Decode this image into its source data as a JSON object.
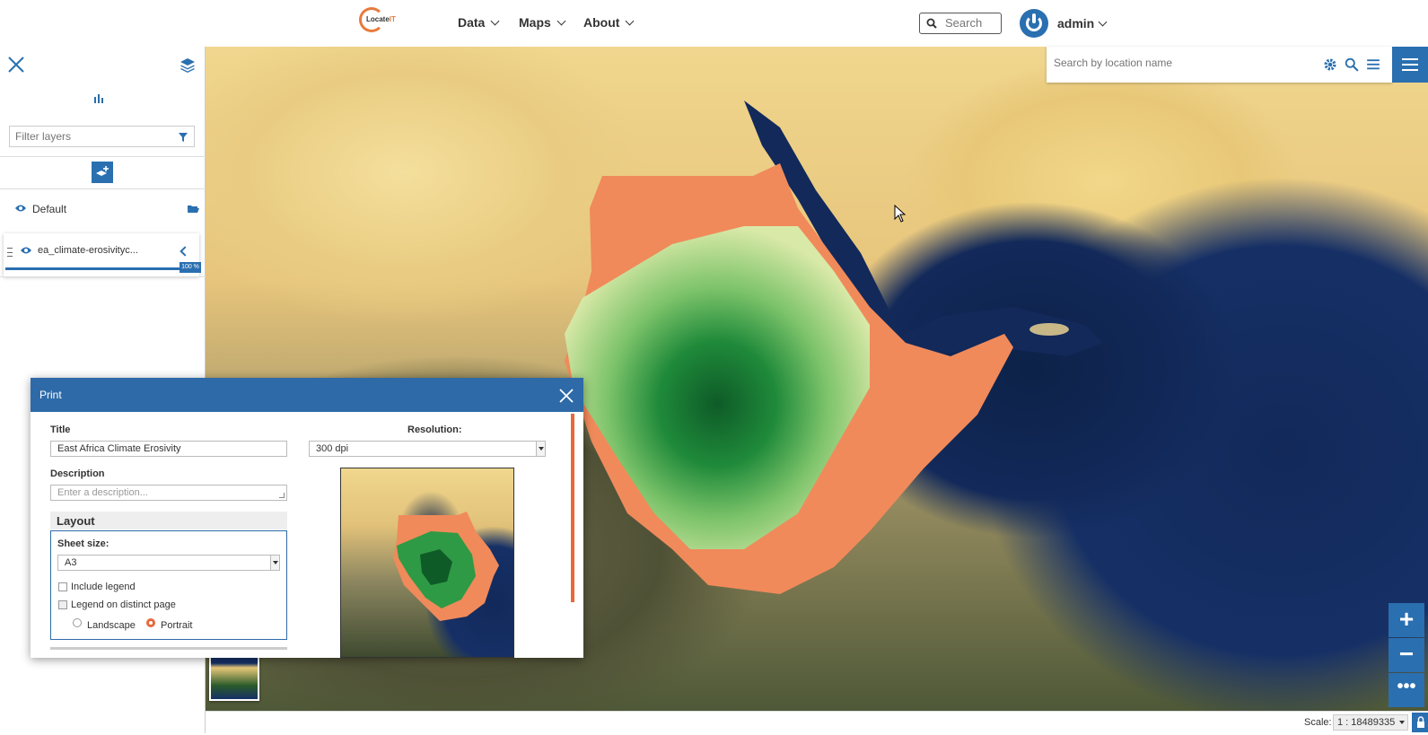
{
  "brand": {
    "logo_text": "Locate",
    "logo_accent": "IT"
  },
  "nav": {
    "items": [
      {
        "label": "Data"
      },
      {
        "label": "Maps"
      },
      {
        "label": "About"
      }
    ]
  },
  "header": {
    "search_placeholder": "Search",
    "user": "admin"
  },
  "map_search": {
    "placeholder": "Search by location name"
  },
  "toc": {
    "filter_placeholder": "Filter layers",
    "group": {
      "label": "Default"
    },
    "layer": {
      "label": "ea_climate-erosivityc...",
      "opacity": "100 %",
      "opacity_value": 1.0
    }
  },
  "print_dialog": {
    "title": "Print",
    "title_label": "Title",
    "title_value": "East Africa Climate Erosivity",
    "description_label": "Description",
    "description_placeholder": "Enter a description...",
    "resolution_label": "Resolution:",
    "resolution_value": "300 dpi",
    "layout_header": "Layout",
    "sheet_size_label": "Sheet size:",
    "sheet_size_value": "A3",
    "include_legend_label": "Include legend",
    "legend_distinct_label": "Legend on distinct page",
    "landscape_label": "Landscape",
    "portrait_label": "Portrait",
    "orientation": "Portrait",
    "include_legend": false,
    "legend_distinct": false
  },
  "statusbar": {
    "scale_label": "Scale:",
    "scale_value": "1 : 18489335"
  },
  "colors": {
    "primary": "#2a6fb0",
    "accent": "#e8683c",
    "dialog_header": "#2e6aa8"
  }
}
